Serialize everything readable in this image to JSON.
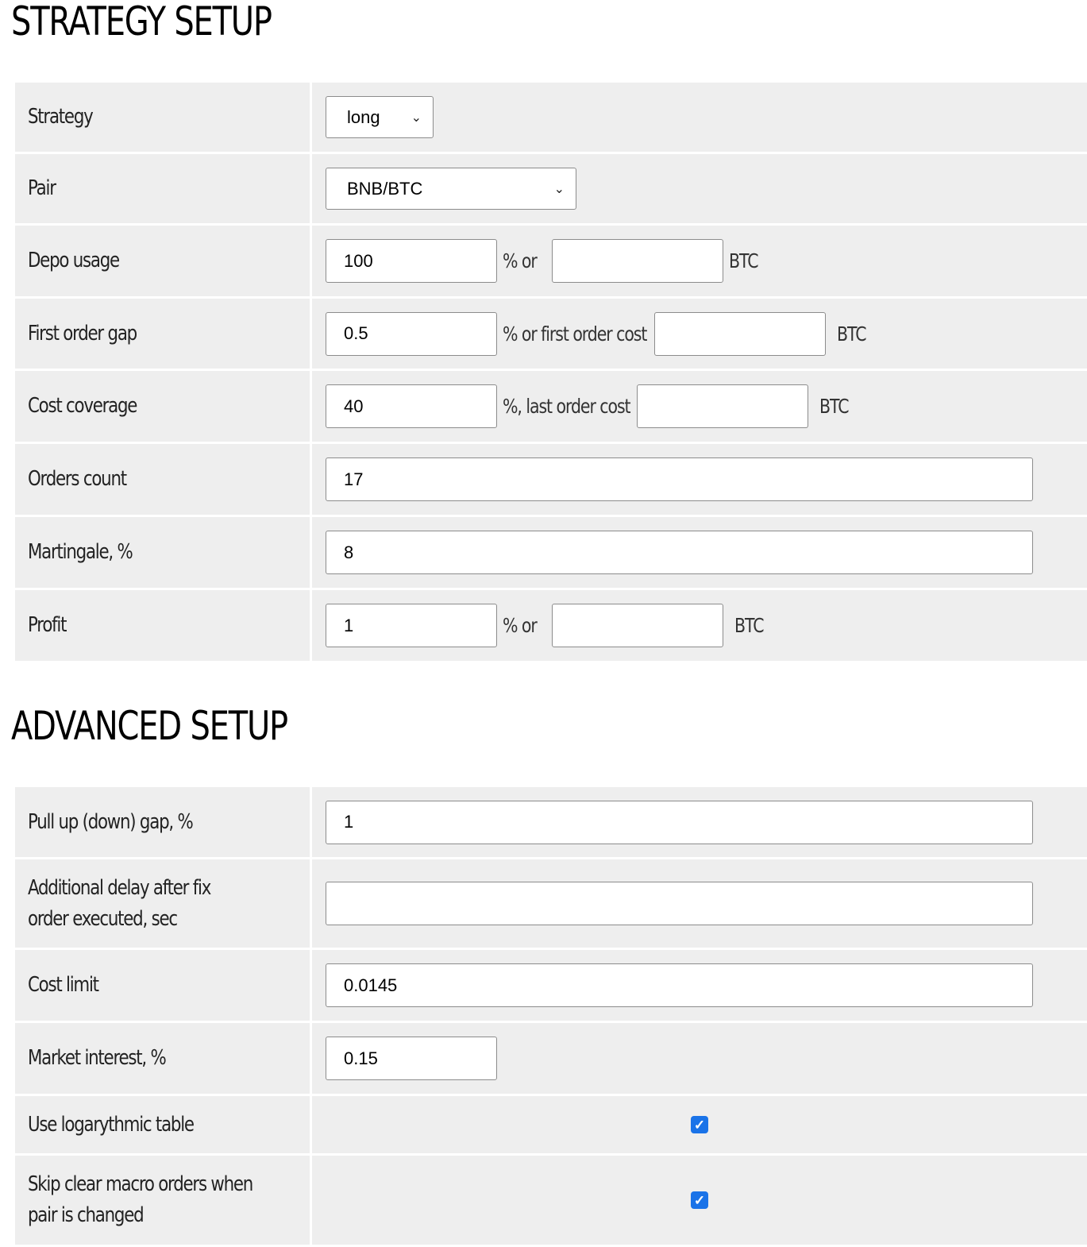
{
  "strategy_setup": {
    "title": "STRATEGY SETUP",
    "strategy": {
      "label": "Strategy",
      "value": "long"
    },
    "pair": {
      "label": "Pair",
      "value": "BNB/BTC"
    },
    "depo_usage": {
      "label": "Depo usage",
      "percent_value": "100",
      "mid_text": "%  or",
      "btc_value": "",
      "unit": "BTC"
    },
    "first_order_gap": {
      "label": "First order gap",
      "percent_value": "0.5",
      "mid_text": "% or first order cost",
      "btc_value": "",
      "unit": "BTC"
    },
    "cost_coverage": {
      "label": "Cost coverage",
      "percent_value": "40",
      "mid_text": "%, last order cost",
      "btc_value": "",
      "unit": "BTC"
    },
    "orders_count": {
      "label": "Orders count",
      "value": "17"
    },
    "martingale": {
      "label": "Martingale, %",
      "value": "8"
    },
    "profit": {
      "label": "Profit",
      "percent_value": "1",
      "mid_text": "%  or",
      "btc_value": "",
      "unit": "BTC"
    }
  },
  "advanced_setup": {
    "title": "ADVANCED SETUP",
    "pull_gap": {
      "label": "Pull up (down) gap, %",
      "value": "1"
    },
    "additional_delay": {
      "label": "Additional delay after fix order executed, sec",
      "value": ""
    },
    "cost_limit": {
      "label": "Cost limit",
      "value": "0.0145"
    },
    "market_interest": {
      "label": "Market interest, %",
      "value": "0.15"
    },
    "use_log_table": {
      "label": "Use logarythmic table",
      "checked": true
    },
    "skip_clear_macro": {
      "label": "Skip clear macro orders when pair is changed",
      "checked": true
    }
  },
  "icons": {
    "select_arrow": "chevron-down-icon",
    "checkbox_mark": "checkmark-icon"
  },
  "colors": {
    "row_bg": "#eeeeee",
    "checkbox_accent": "#1a73e8"
  }
}
